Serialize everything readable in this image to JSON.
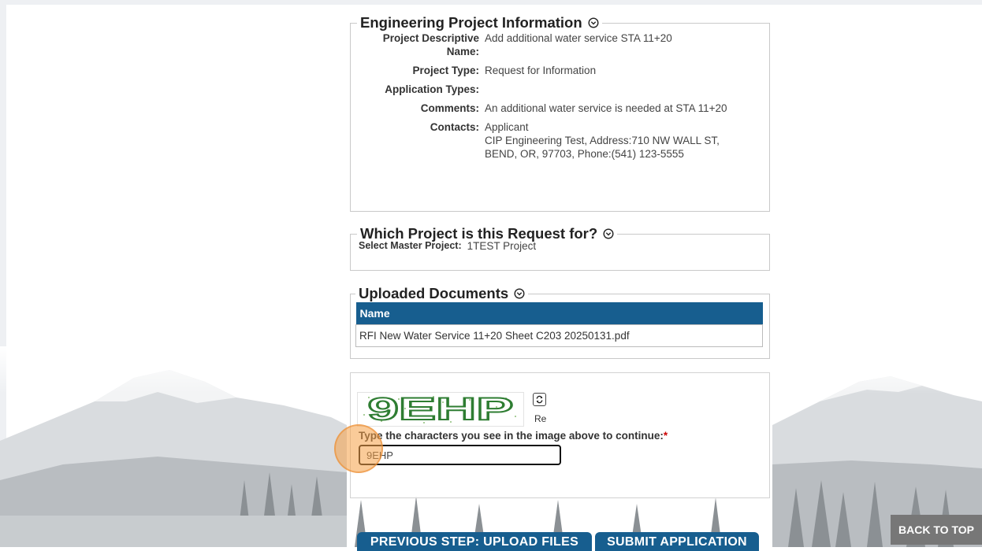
{
  "engineering_project": {
    "title": "Engineering Project Information",
    "fields": [
      {
        "label": "Project Descriptive Name:",
        "value": "Add additional water service STA 11+20"
      },
      {
        "label": "Project Type:",
        "value": "Request for Information"
      },
      {
        "label": "Application Types:",
        "value": ""
      },
      {
        "label": "Comments:",
        "value": "An additional water service is needed at STA 11+20"
      },
      {
        "label": "Contacts:",
        "value": "Applicant",
        "value_detail": "CIP Engineering Test, Address:710 NW WALL ST, BEND, OR, 97703, Phone:(541) 123-5555"
      }
    ]
  },
  "request_project": {
    "title": "Which Project is this Request for?",
    "label": "Select Master Project:",
    "value": "1TEST Project"
  },
  "uploaded_documents": {
    "title": "Uploaded Documents",
    "column_header": "Name",
    "rows": [
      "RFI New Water Service 11+20 Sheet C203 20250131.pdf"
    ]
  },
  "captcha": {
    "image_text": "9EHP",
    "refresh_label": "Re",
    "prompt": "Type the characters you see in the image above to continue:",
    "required_mark": "*",
    "input_value": "9EHP"
  },
  "buttons": {
    "previous": "PREVIOUS STEP: UPLOAD FILES",
    "submit": "SUBMIT APPLICATION",
    "back_to_top": "BACK TO TOP"
  },
  "colors": {
    "primary": "#175e8f",
    "back_to_top": "#777777",
    "required": "#cc0000",
    "click_marker": "#f5a046"
  }
}
